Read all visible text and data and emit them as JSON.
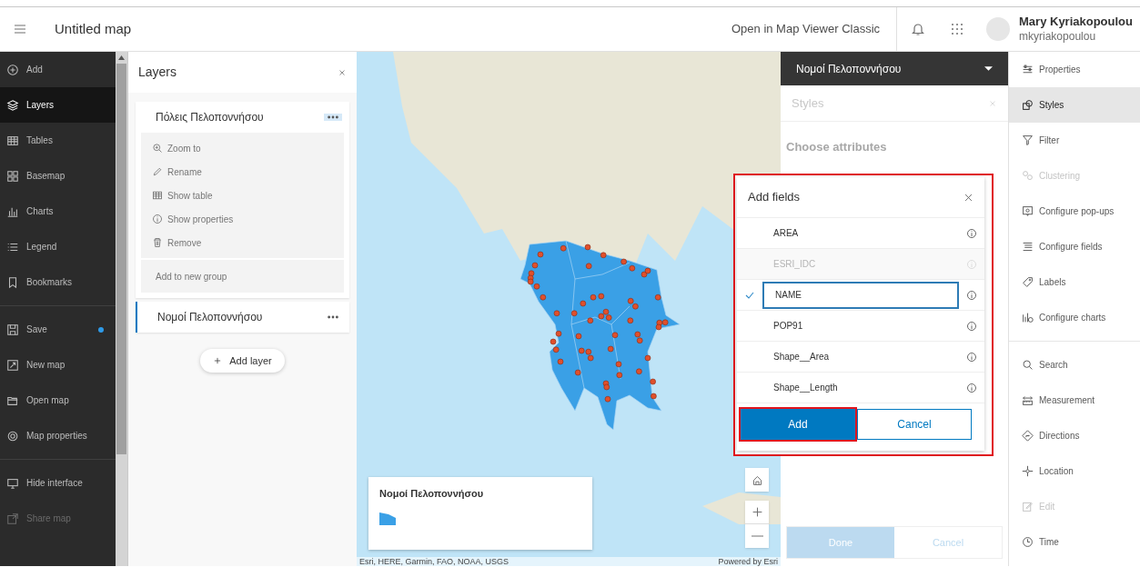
{
  "header": {
    "title": "Untitled map",
    "classic_link": "Open in Map Viewer Classic",
    "user_name": "Mary Kyriakopoulou",
    "user_id": "mkyriakopoulou"
  },
  "nav": [
    {
      "label": "Add",
      "selected": false,
      "disabled": false,
      "dot": false
    },
    {
      "label": "Layers",
      "selected": true,
      "disabled": false,
      "dot": false
    },
    {
      "label": "Tables",
      "selected": false,
      "disabled": false,
      "dot": false
    },
    {
      "label": "Basemap",
      "selected": false,
      "disabled": false,
      "dot": false
    },
    {
      "label": "Charts",
      "selected": false,
      "disabled": false,
      "dot": false
    },
    {
      "label": "Legend",
      "selected": false,
      "disabled": false,
      "dot": false
    },
    {
      "label": "Bookmarks",
      "selected": false,
      "disabled": false,
      "dot": false
    },
    {
      "label": "Save",
      "selected": false,
      "disabled": false,
      "dot": true
    },
    {
      "label": "New map",
      "selected": false,
      "disabled": false,
      "dot": false
    },
    {
      "label": "Open map",
      "selected": false,
      "disabled": false,
      "dot": false
    },
    {
      "label": "Map properties",
      "selected": false,
      "disabled": false,
      "dot": false
    },
    {
      "label": "Hide interface",
      "selected": false,
      "disabled": false,
      "dot": false
    },
    {
      "label": "Share map",
      "selected": false,
      "disabled": true,
      "dot": false
    }
  ],
  "layers_panel": {
    "title": "Layers",
    "layers": [
      {
        "name": "Πόλεις Πελοποννήσου",
        "selected": false,
        "expanded": true,
        "menu": [
          "Zoom to",
          "Rename",
          "Show table",
          "Show properties",
          "Remove"
        ],
        "group_action": "Add to new group"
      },
      {
        "name": "Νομοί Πελοποννήσου",
        "selected": true,
        "expanded": false
      }
    ],
    "add_button": "Add layer"
  },
  "map": {
    "legend_title": "Νομοί Πελοποννήσου",
    "attribution": "Esri, HERE, Garmin, FAO, NOAA, USGS",
    "powered_by": "Powered by Esri"
  },
  "styles_panel": {
    "layer": "Νομοί Πελοποννήσου",
    "title": "Styles",
    "subtitle": "Choose attributes",
    "done": "Done",
    "cancel": "Cancel"
  },
  "dialog": {
    "title": "Add fields",
    "fields": [
      {
        "name": "AREA",
        "checked": false,
        "disabled": false
      },
      {
        "name": "ESRI_IDC",
        "checked": false,
        "disabled": true
      },
      {
        "name": "NAME",
        "checked": true,
        "disabled": false
      },
      {
        "name": "POP91",
        "checked": false,
        "disabled": false
      },
      {
        "name": "Shape__Area",
        "checked": false,
        "disabled": false
      },
      {
        "name": "Shape__Length",
        "checked": false,
        "disabled": false
      }
    ],
    "add": "Add",
    "cancel": "Cancel"
  },
  "tools": [
    {
      "label": "Properties",
      "selected": false,
      "disabled": false
    },
    {
      "label": "Styles",
      "selected": true,
      "disabled": false
    },
    {
      "label": "Filter",
      "selected": false,
      "disabled": false
    },
    {
      "label": "Clustering",
      "selected": false,
      "disabled": true
    },
    {
      "label": "Configure pop-ups",
      "selected": false,
      "disabled": false
    },
    {
      "label": "Configure fields",
      "selected": false,
      "disabled": false
    },
    {
      "label": "Labels",
      "selected": false,
      "disabled": false
    },
    {
      "label": "Configure charts",
      "selected": false,
      "disabled": false
    },
    {
      "label": "Search",
      "selected": false,
      "disabled": false
    },
    {
      "label": "Measurement",
      "selected": false,
      "disabled": false
    },
    {
      "label": "Directions",
      "selected": false,
      "disabled": false
    },
    {
      "label": "Location",
      "selected": false,
      "disabled": false
    },
    {
      "label": "Edit",
      "selected": false,
      "disabled": true
    },
    {
      "label": "Time",
      "selected": false,
      "disabled": false
    }
  ]
}
